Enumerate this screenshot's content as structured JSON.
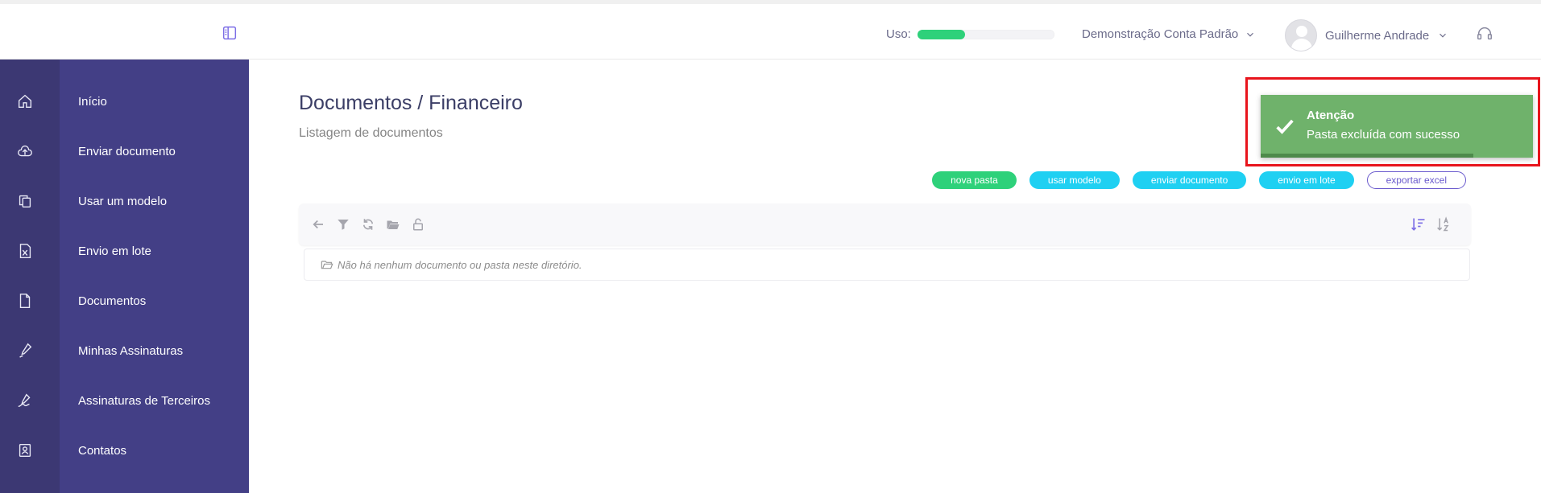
{
  "header": {
    "usage_label": "Uso:",
    "usage_fraction": 0.35,
    "account_name": "Demonstração Conta Padrão",
    "user_name": "Guilherme Andrade"
  },
  "sidebar": {
    "items": [
      {
        "label": "Início",
        "icon": "home-icon"
      },
      {
        "label": "Enviar documento",
        "icon": "cloud-upload-icon"
      },
      {
        "label": "Usar um modelo",
        "icon": "copy-template-icon"
      },
      {
        "label": "Envio em lote",
        "icon": "excel-file-icon"
      },
      {
        "label": "Documentos",
        "icon": "document-icon"
      },
      {
        "label": "Minhas Assinaturas",
        "icon": "pen-icon"
      },
      {
        "label": "Assinaturas de Terceiros",
        "icon": "signature-icon"
      },
      {
        "label": "Contatos",
        "icon": "contacts-icon"
      }
    ]
  },
  "main": {
    "title": "Documentos / Financeiro",
    "subtitle": "Listagem de documentos",
    "actions": {
      "new_folder": "nova pasta",
      "use_template": "usar modelo",
      "send_document": "enviar documento",
      "batch_send": "envio em lote",
      "export_excel": "exportar excel"
    },
    "empty_message": "Não há nenhum documento ou pasta neste diretório."
  },
  "toast": {
    "title": "Atenção",
    "message": "Pasta excluída com sucesso",
    "progress_fraction": 0.78
  },
  "colors": {
    "sidebar": "#433f86",
    "rail": "#3c3873",
    "green": "#2ed17a",
    "cyan": "#1fd0f2",
    "toast": "#6fb26b",
    "highlight": "#e8141c"
  }
}
